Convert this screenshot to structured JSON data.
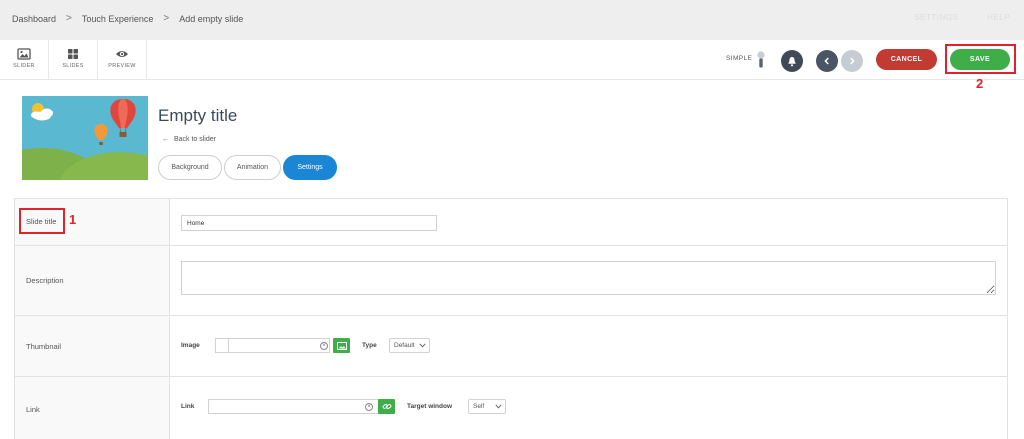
{
  "breadcrumb": {
    "items": [
      "Dashboard",
      "Touch Experience",
      "Add empty slide"
    ],
    "separator": ">"
  },
  "top_links": [
    "SETTINGS",
    "HELP"
  ],
  "toolbar": {
    "tools": [
      {
        "label": "SLIDER",
        "icon": "image-icon"
      },
      {
        "label": "SLIDES",
        "icon": "grid-icon"
      },
      {
        "label": "PREVIEW",
        "icon": "eye-icon"
      }
    ],
    "mode_label": "SIMPLE",
    "cancel_label": "CANCEL",
    "save_label": "SAVE"
  },
  "annotations": {
    "one": "1",
    "two": "2"
  },
  "slide": {
    "title": "Empty title",
    "back_link": "Back to slider",
    "tabs": [
      {
        "label": "Background",
        "active": false
      },
      {
        "label": "Animation",
        "active": false
      },
      {
        "label": "Settings",
        "active": true
      }
    ]
  },
  "settings": {
    "slide_title": {
      "label": "Slide title",
      "value": "Home"
    },
    "description": {
      "label": "Description",
      "value": ""
    },
    "thumbnail": {
      "label": "Thumbnail",
      "image_label": "Image",
      "image_value": "",
      "type_label": "Type",
      "type_value": "Default"
    },
    "link": {
      "label": "Link",
      "link_label": "Link",
      "link_value": "",
      "target_label": "Target window",
      "target_value": "Self"
    }
  },
  "colors": {
    "accent_blue": "#1b86d6",
    "save_green": "#3fae49",
    "cancel_red": "#c23b32",
    "annotation_red": "#e0232a"
  }
}
